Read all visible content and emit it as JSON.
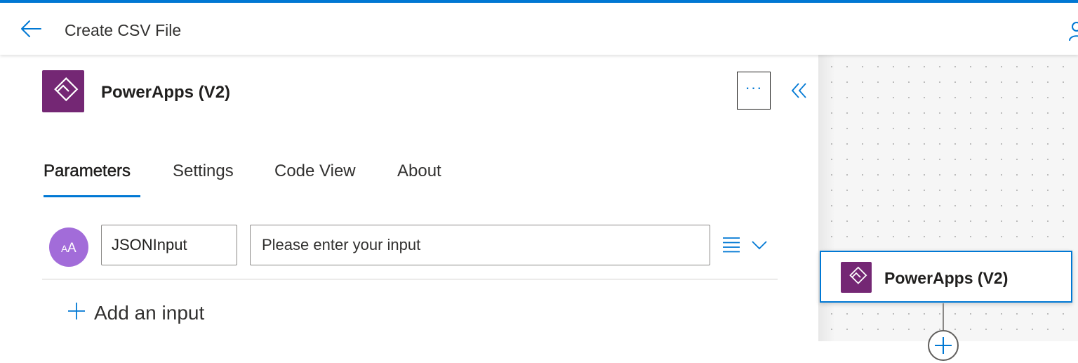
{
  "header": {
    "title": "Create CSV File"
  },
  "operation": {
    "title": "PowerApps (V2)",
    "more_label": "···"
  },
  "tabs": [
    {
      "label": "Parameters",
      "active": true
    },
    {
      "label": "Settings",
      "active": false
    },
    {
      "label": "Code View",
      "active": false
    },
    {
      "label": "About",
      "active": false
    }
  ],
  "parameter": {
    "avatar_text": "AA",
    "name": "JSONInput",
    "value_placeholder": "Please enter your input"
  },
  "add_input_label": "Add an input",
  "canvas": {
    "node_title": "PowerApps (V2)"
  },
  "colors": {
    "accent": "#0078d4",
    "powerapps_brand": "#742774",
    "avatar": "#a26cd9"
  },
  "icons": {
    "back": "back-arrow-icon",
    "user": "user-icon",
    "powerapps": "powerapps-icon",
    "more": "more-icon",
    "collapse": "double-chevron-left-icon",
    "menu": "list-icon",
    "expand": "chevron-down-icon",
    "add": "plus-icon"
  }
}
